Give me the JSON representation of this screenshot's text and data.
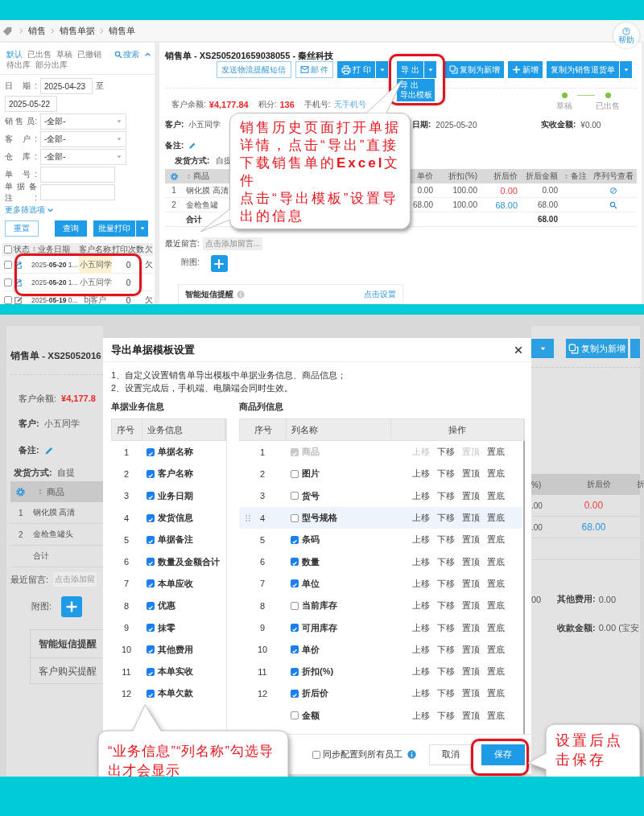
{
  "top_screen": {
    "breadcrumb": [
      "销售",
      "销售单据",
      "销售单"
    ],
    "help_button": "帮助",
    "filter_tabs": [
      {
        "label": "默认",
        "selected": true
      },
      {
        "label": "已出售",
        "selected": false
      },
      {
        "label": "草稿",
        "selected": false
      },
      {
        "label": "已撤销",
        "selected": false
      },
      {
        "label": "待出库",
        "selected": false
      },
      {
        "label": "部分出库",
        "selected": false
      }
    ],
    "search_link": "搜索",
    "filters": [
      {
        "kind": "date_range",
        "label": "日 期:",
        "from": "2025-04-23",
        "separator": "至",
        "to": "2025-05-22"
      },
      {
        "kind": "select",
        "label": "销 售 员:",
        "value": "-全部-"
      },
      {
        "kind": "select",
        "label": "客 户:",
        "value": "-全部-"
      },
      {
        "kind": "select",
        "label": "仓 库:",
        "value": "-全部-"
      },
      {
        "kind": "input",
        "label": "单 号:"
      },
      {
        "kind": "input",
        "label": "单据备注:"
      }
    ],
    "more_filters": "更多筛选项",
    "filter_buttons": [
      {
        "kind": "outline",
        "label": "重置"
      },
      {
        "kind": "primary",
        "label": "查询"
      },
      {
        "kind": "split",
        "label": "批量打印"
      }
    ],
    "list_table": {
      "all_checked": false,
      "columns": [
        {
          "label": "状态",
          "sortable": false
        },
        {
          "label": "业务日期",
          "sortable": true
        },
        {
          "label": "客户名称",
          "sortable": false
        },
        {
          "label": "打印次数",
          "sortable": false
        },
        {
          "label": "欠",
          "sortable": false
        }
      ],
      "rows": [
        {
          "checked": false,
          "kind": "sold",
          "date": "2025-**05-20** 1...",
          "customer": "小五同学",
          "highlighted": true,
          "prints": "0",
          "owe": "欠"
        },
        {
          "checked": false,
          "kind": "sold",
          "date": "2025-**05-20** 1...",
          "customer": "小五同学",
          "highlighted": false,
          "prints": "0"
        },
        {
          "checked": false,
          "kind": "draft",
          "date": "2025-**05-19** 0...",
          "customer": "bj客户",
          "highlighted": false,
          "prints": "0",
          "owe": "欠"
        }
      ]
    },
    "order": {
      "title": "销售单 - XS2505201659038055 - 秦丝科技",
      "toolbar": [
        {
          "kind": "outline",
          "label": "发送物流提醒短信"
        },
        {
          "kind": "mail",
          "label": "邮 件"
        },
        {
          "kind": "print",
          "label": "打 印"
        },
        {
          "kind": "export",
          "label": "导 出",
          "menu": [
            "导 出",
            "导出模板"
          ]
        },
        {
          "kind": "copy",
          "label": "复制为新增"
        },
        {
          "kind": "add",
          "label": "新增"
        },
        {
          "kind": "split",
          "label": "复制为销售退货单"
        }
      ],
      "summary": [
        {
          "label": "客户余额:",
          "value": "¥4,177.84",
          "kind": "alert"
        },
        {
          "label": "积分:",
          "value": "136",
          "kind": "alert"
        },
        {
          "label": "手机号:",
          "value": "无手机号",
          "kind": "link"
        }
      ],
      "progress": [
        {
          "label": "草稿",
          "done": true
        },
        {
          "label": "已出售",
          "done": true
        }
      ],
      "info_fields": [
        {
          "label": "客户:",
          "value": "小五同学"
        },
        {
          "label": "日期:",
          "value": "2025-05-20"
        },
        {
          "label": "实收金额:",
          "value": "¥0.00"
        }
      ],
      "remark_label": "备注:",
      "shipping": {
        "label": "发货方式:",
        "value": "自提"
      },
      "items_table": {
        "columns": [
          {
            "label": "商品",
            "sortable": true
          },
          {
            "label": "单价",
            "sortable": false
          },
          {
            "label": "折扣(%)",
            "sortable": false
          },
          {
            "label": "折后价",
            "sortable": false
          },
          {
            "label": "折后金额",
            "sortable": false
          },
          {
            "label": "备注",
            "sortable": true
          },
          {
            "label": "序列号查看",
            "sortable": false
          }
        ],
        "rows": [
          {
            "index": "1",
            "name": "钢化膜  高清",
            "price": "0.00",
            "discount": "100.00",
            "net_price": "0.00",
            "color": "#f04040",
            "amount": "0.00",
            "kind": "none"
          },
          {
            "index": "2",
            "name": "金枪鱼罐",
            "price": "68.00",
            "discount": "100.00",
            "net_price": "68.00",
            "color": "#2f95dc",
            "amount": "68.00",
            "kind": "view"
          }
        ],
        "total_label": "合计",
        "total": "68.00"
      },
      "message": {
        "label": "最近留言:",
        "placeholder": "点击添加留言..."
      },
      "attachment_label": "附图:",
      "sms_panel": {
        "title": "智能短信提醒",
        "link": "点击设置"
      }
    },
    "callout": {
      "paragraphs": [
        "销售历史页面打开单据详情，点击“导出”直接下载销售单的**Excel**文件",
        "点击“导出模板”设置导出的信息"
      ]
    }
  },
  "bottom_screen": {
    "left_page": {
      "title": "销售单 - XS25052016",
      "balance_label": "客户余额:",
      "balance": "¥4,177.8",
      "customer_label": "客户:",
      "customer": "小五同学",
      "remark_label": "备注:",
      "shipping_label": "发货方式:",
      "shipping": "自提",
      "product_header": "商品",
      "rows": [
        {
          "index": "1",
          "name": "钢化膜  高清"
        },
        {
          "index": "2",
          "name": "金枪鱼罐头"
        }
      ],
      "total_label": "合计",
      "message_label": "最近留言:",
      "message_placeholder": "点击添加留",
      "attachment_label": "附图:",
      "sms_title": "智能短信提醒",
      "sms_item": "客户购买提醒"
    },
    "right_page": {
      "toolbar": [
        {
          "kind": "dropdown"
        },
        {
          "kind": "copy",
          "label": "复制为新增"
        },
        {
          "kind": "edge"
        }
      ],
      "header": [
        "%)",
        "折后价",
        "折"
      ],
      "rows": [
        {
          "discount": ".00",
          "net_price": "0.00",
          "color": "#f04040"
        },
        {
          "discount": ".00",
          "net_price": "68.00",
          "color": "#2f95dc"
        }
      ],
      "fees": [
        {
          "prefix": "00",
          "label": "其他费用:",
          "value": "0.00"
        },
        {
          "label": "收款金额:",
          "value": "0.00 (宝安"
        }
      ]
    },
    "modal": {
      "title": "导出单据模板设置",
      "notes": [
        "1、自定义设置销售单导出模板中单据业务信息、商品信息；",
        "2、设置完成后，手机端、电脑端会同时生效。"
      ],
      "business": {
        "title": "单据业务信息",
        "columns": [
          "序号",
          "业务信息"
        ],
        "rows": [
          {
            "index": "1",
            "label": "单据名称",
            "checked": true
          },
          {
            "index": "2",
            "label": "客户名称",
            "checked": true
          },
          {
            "index": "3",
            "label": "业务日期",
            "checked": true
          },
          {
            "index": "4",
            "label": "发货信息",
            "checked": true
          },
          {
            "index": "5",
            "label": "单据备注",
            "checked": true
          },
          {
            "index": "6",
            "label": "数量及金额合计",
            "checked": true
          },
          {
            "index": "7",
            "label": "本单应收",
            "checked": true
          },
          {
            "index": "8",
            "label": "优惠",
            "checked": true
          },
          {
            "index": "9",
            "label": "抹零",
            "checked": true
          },
          {
            "index": "10",
            "label": "其他费用",
            "checked": true
          },
          {
            "index": "11",
            "label": "本单实收",
            "checked": true
          },
          {
            "index": "12",
            "label": "本单欠款",
            "checked": true
          }
        ]
      },
      "product_columns": {
        "title": "商品列信息",
        "columns": [
          "序号",
          "列名称",
          "操作"
        ],
        "rows": [
          {
            "index": "1",
            "label": "商品",
            "checked": true,
            "disabled": true,
            "highlighted": false,
            "ops": [
              {
                "label": "上移",
                "disabled": true
              },
              {
                "label": "下移",
                "disabled": false
              },
              {
                "label": "置顶",
                "disabled": true
              },
              {
                "label": "置底",
                "disabled": false
              }
            ]
          },
          {
            "index": "2",
            "label": "图片",
            "checked": false,
            "disabled": false,
            "highlighted": false,
            "ops": [
              {
                "label": "上移",
                "disabled": false
              },
              {
                "label": "下移",
                "disabled": false
              },
              {
                "label": "置顶",
                "disabled": false
              },
              {
                "label": "置底",
                "disabled": false
              }
            ]
          },
          {
            "index": "3",
            "label": "货号",
            "checked": false,
            "disabled": false,
            "highlighted": false,
            "ops": [
              {
                "label": "上移",
                "disabled": false
              },
              {
                "label": "下移",
                "disabled": false
              },
              {
                "label": "置顶",
                "disabled": false
              },
              {
                "label": "置底",
                "disabled": false
              }
            ]
          },
          {
            "index": "4",
            "label": "型号规格",
            "checked": false,
            "disabled": false,
            "highlighted": true,
            "ops": [
              {
                "label": "上移",
                "disabled": false
              },
              {
                "label": "下移",
                "disabled": false
              },
              {
                "label": "置顶",
                "disabled": false
              },
              {
                "label": "置底",
                "disabled": false
              }
            ]
          },
          {
            "index": "5",
            "label": "条码",
            "checked": true,
            "disabled": false,
            "highlighted": false,
            "ops": [
              {
                "label": "上移",
                "disabled": false
              },
              {
                "label": "下移",
                "disabled": false
              },
              {
                "label": "置顶",
                "disabled": false
              },
              {
                "label": "置底",
                "disabled": false
              }
            ]
          },
          {
            "index": "6",
            "label": "数量",
            "checked": true,
            "disabled": false,
            "highlighted": false,
            "ops": [
              {
                "label": "上移",
                "disabled": false
              },
              {
                "label": "下移",
                "disabled": false
              },
              {
                "label": "置顶",
                "disabled": false
              },
              {
                "label": "置底",
                "disabled": false
              }
            ]
          },
          {
            "index": "7",
            "label": "单位",
            "checked": true,
            "disabled": false,
            "highlighted": false,
            "ops": [
              {
                "label": "上移",
                "disabled": false
              },
              {
                "label": "下移",
                "disabled": false
              },
              {
                "label": "置顶",
                "disabled": false
              },
              {
                "label": "置底",
                "disabled": false
              }
            ]
          },
          {
            "index": "8",
            "label": "当前库存",
            "checked": false,
            "disabled": false,
            "highlighted": false,
            "ops": [
              {
                "label": "上移",
                "disabled": false
              },
              {
                "label": "下移",
                "disabled": false
              },
              {
                "label": "置顶",
                "disabled": false
              },
              {
                "label": "置底",
                "disabled": false
              }
            ]
          },
          {
            "index": "9",
            "label": "可用库存",
            "checked": true,
            "disabled": false,
            "highlighted": false,
            "ops": [
              {
                "label": "上移",
                "disabled": false
              },
              {
                "label": "下移",
                "disabled": false
              },
              {
                "label": "置顶",
                "disabled": false
              },
              {
                "label": "置底",
                "disabled": false
              }
            ]
          },
          {
            "index": "10",
            "label": "单价",
            "checked": true,
            "disabled": false,
            "highlighted": false,
            "ops": [
              {
                "label": "上移",
                "disabled": false
              },
              {
                "label": "下移",
                "disabled": false
              },
              {
                "label": "置顶",
                "disabled": false
              },
              {
                "label": "置底",
                "disabled": false
              }
            ]
          },
          {
            "index": "11",
            "label": "折扣(%)",
            "checked": true,
            "disabled": false,
            "highlighted": false,
            "ops": [
              {
                "label": "上移",
                "disabled": false
              },
              {
                "label": "下移",
                "disabled": false
              },
              {
                "label": "置顶",
                "disabled": false
              },
              {
                "label": "置底",
                "disabled": false
              }
            ]
          },
          {
            "index": "12",
            "label": "折后价",
            "checked": true,
            "disabled": false,
            "highlighted": false,
            "ops": [
              {
                "label": "上移",
                "disabled": false
              },
              {
                "label": "下移",
                "disabled": false
              },
              {
                "label": "置顶",
                "disabled": false
              },
              {
                "label": "置底",
                "disabled": false
              }
            ]
          },
          {
            "label": "金额",
            "checked": false,
            "disabled": false,
            "highlighted": false,
            "ops": [
              {
                "label": "上移",
                "disabled": false
              },
              {
                "label": "下移",
                "disabled": false
              },
              {
                "label": "置顶",
                "disabled": false
              },
              {
                "label": "置底",
                "disabled": false
              }
            ]
          }
        ]
      },
      "sync": {
        "label": "同步配置到所有员工",
        "checked": false
      },
      "buttons": [
        {
          "kind": "secondary",
          "label": "取消"
        },
        {
          "kind": "primary",
          "label": "保存"
        }
      ]
    },
    "callouts": [
      {
        "text": "“业务信息”“列名称”勾选导出才会显示"
      },
      {
        "text": "设置后点击保存"
      }
    ]
  }
}
